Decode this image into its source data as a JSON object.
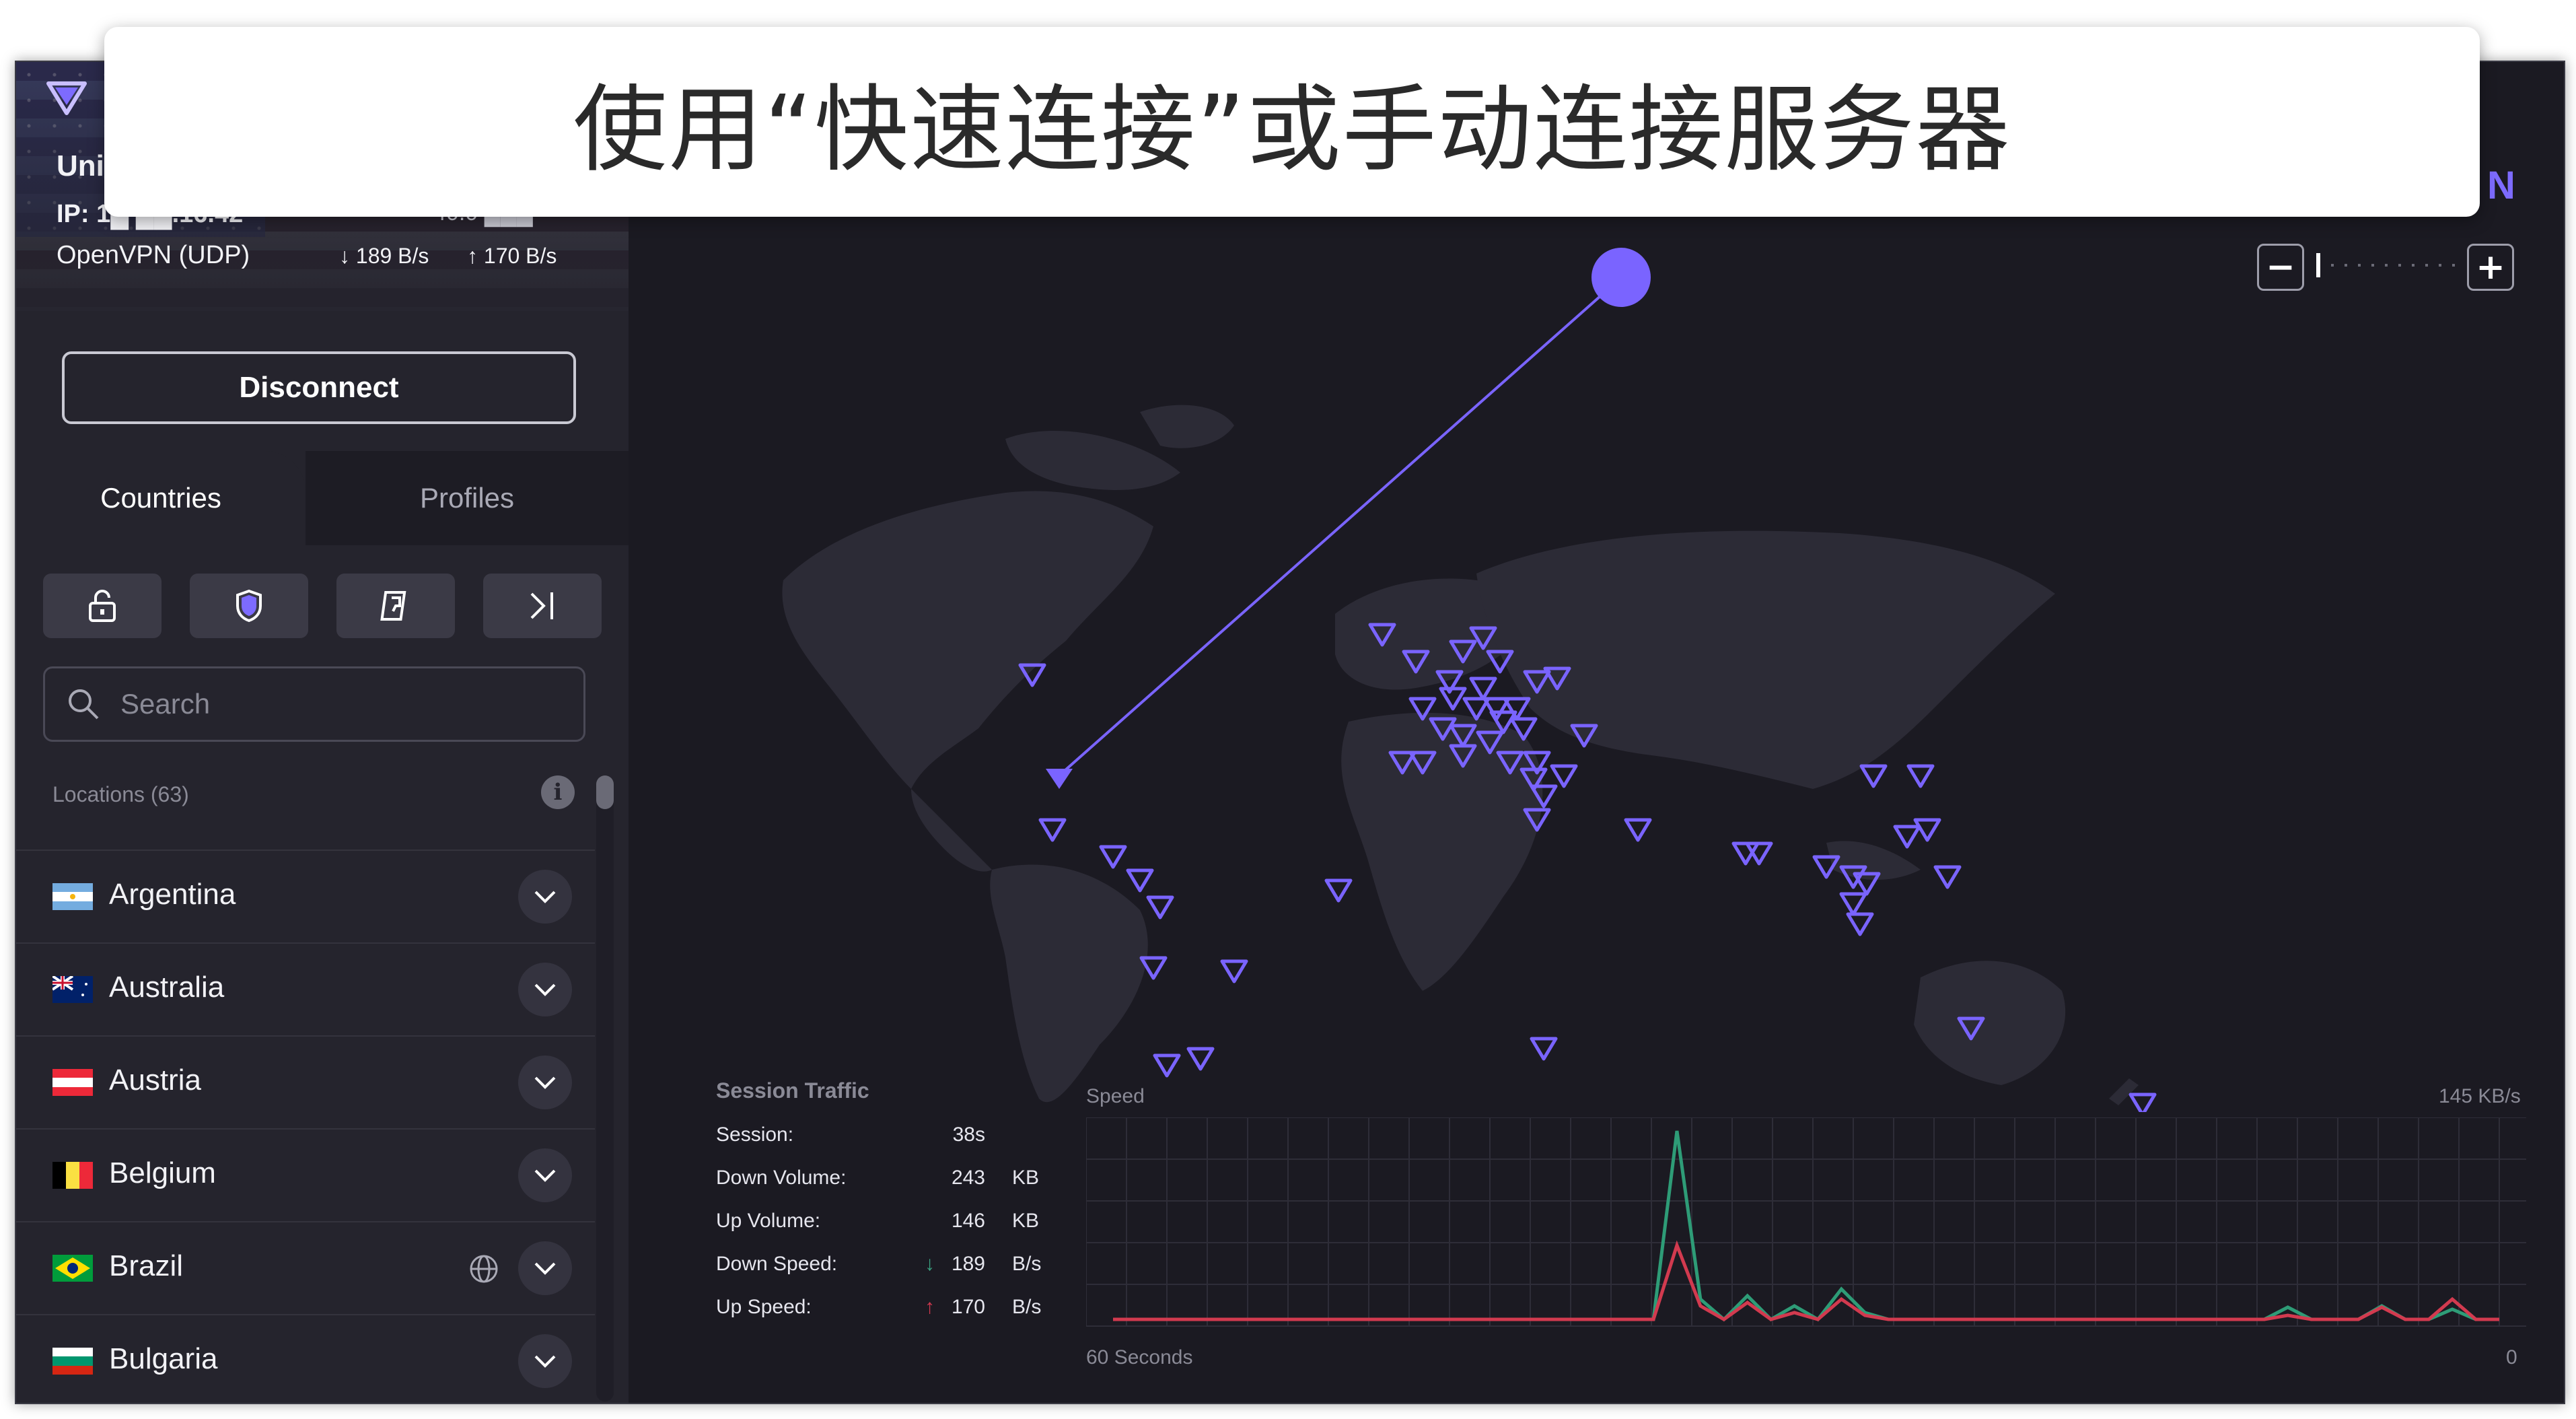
{
  "caption": "使用“快速连接”或手动连接服务器",
  "window": {
    "close_glyph": "✕",
    "brand_letter": "N"
  },
  "connection": {
    "server": "Uni",
    "ip_label": "IP:",
    "ip_value": "1█ ██.16.42",
    "ip_right": "40.0 ███",
    "protocol": "OpenVPN (UDP)",
    "down_rate": "↓ 189 B/s",
    "up_rate": "↑ 170 B/s"
  },
  "disconnect_label": "Disconnect",
  "tabs": {
    "countries": "Countries",
    "profiles": "Profiles"
  },
  "filters": [
    "lock-icon",
    "shield-icon",
    "p2p-icon",
    "tor-icon"
  ],
  "search": {
    "placeholder": "Search"
  },
  "locations": {
    "header": "Locations (63)",
    "info": "i"
  },
  "countries": [
    {
      "name": "Argentina",
      "flag": "ar"
    },
    {
      "name": "Australia",
      "flag": "au"
    },
    {
      "name": "Austria",
      "flag": "at"
    },
    {
      "name": "Belgium",
      "flag": "be"
    },
    {
      "name": "Brazil",
      "flag": "br",
      "globe": true
    },
    {
      "name": "Bulgaria",
      "flag": "bg"
    }
  ],
  "zoom": {
    "minus": "−",
    "plus": "+"
  },
  "session_traffic": {
    "title": "Session Traffic",
    "rows": [
      {
        "label": "Session:",
        "value": "38s",
        "unit": ""
      },
      {
        "label": "Down Volume:",
        "value": "243",
        "unit": "KB"
      },
      {
        "label": "Up Volume:",
        "value": "146",
        "unit": "KB"
      },
      {
        "label": "Down Speed:",
        "value": "189",
        "unit": "B/s",
        "arrow": "↓"
      },
      {
        "label": "Up Speed:",
        "value": "170",
        "unit": "B/s",
        "arrow": "↑"
      }
    ]
  },
  "speed_graph": {
    "label": "Speed",
    "max_label": "145  KB/s",
    "time_start": "60 Seconds",
    "time_end": "0",
    "down_color": "#2e9c77",
    "up_color": "#d23a4f"
  },
  "colors": {
    "accent": "#7d6bff",
    "marker": "#7a64ff",
    "background": "#1b1a22",
    "sidebar": "#25242d"
  }
}
